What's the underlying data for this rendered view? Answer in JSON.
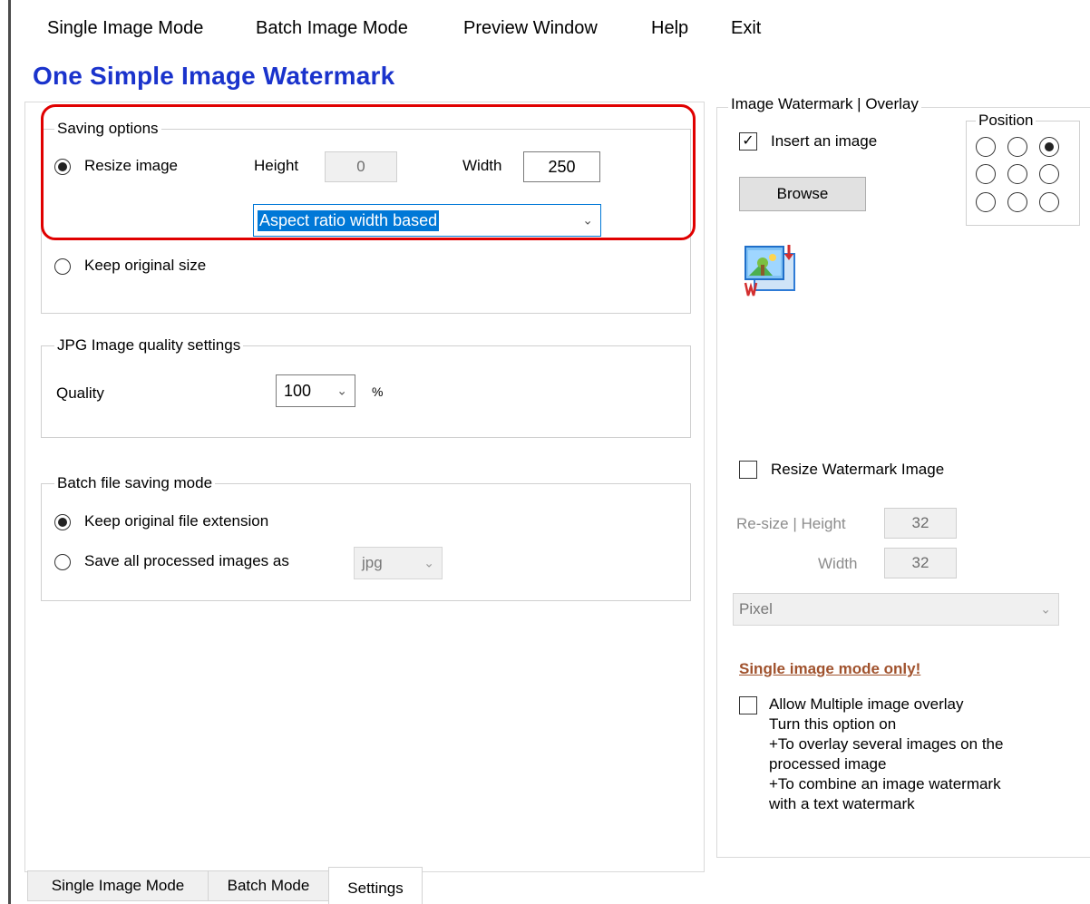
{
  "menu": [
    "Single Image Mode",
    "Batch Image Mode",
    "Preview Window",
    "Help",
    "Exit"
  ],
  "app_title": "One Simple Image Watermark",
  "saving": {
    "legend": "Saving options",
    "resize_label": "Resize image",
    "height_label": "Height",
    "height_value": "0",
    "width_label": "Width",
    "width_value": "250",
    "mode_value": "Aspect ratio width based",
    "keep_label": "Keep original size"
  },
  "jpg": {
    "legend": "JPG Image quality settings",
    "quality_label": "Quality",
    "quality_value": "100",
    "percent": "%"
  },
  "batch": {
    "legend": "Batch file saving mode",
    "keep_ext_label": "Keep original file extension",
    "save_all_label": "Save all processed images as",
    "format_value": "jpg"
  },
  "watermark": {
    "legend": "Image Watermark | Overlay",
    "insert_label": "Insert an image",
    "browse_label": "Browse",
    "position_legend": "Position",
    "position_selected_index": 2,
    "resize_wm_label": "Resize Watermark Image",
    "resize_height_label": "Re-size | Height",
    "resize_height_value": "32",
    "resize_width_label": "Width",
    "resize_width_value": "32",
    "unit_value": "Pixel",
    "single_only": "Single image mode only!",
    "multi_label": "Allow Multiple image overlay",
    "multi_desc": [
      "Turn this option on",
      "+To overlay several images on the",
      "processed image",
      "+To combine an image watermark",
      "with a text watermark"
    ]
  },
  "tabs": [
    "Single Image Mode",
    "Batch Mode",
    "Settings"
  ],
  "colors": {
    "title": "#1a33cc",
    "highlight": "#e00000",
    "selection": "#0078d7",
    "warning": "#a0522d"
  }
}
